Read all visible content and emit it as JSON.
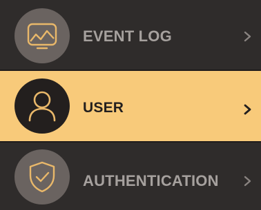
{
  "menu": {
    "items": [
      {
        "label": "EVENT LOG",
        "icon": "image-icon",
        "selected": false
      },
      {
        "label": "USER",
        "icon": "user-icon",
        "selected": true
      },
      {
        "label": "AUTHENTICATION",
        "icon": "shield-check-icon",
        "selected": false
      }
    ]
  },
  "colors": {
    "background": "#2f2c2b",
    "selected_background": "#f8ca7a",
    "accent": "#e9b86a",
    "inactive_text": "#a6a19e",
    "selected_text": "#231f1e",
    "icon_circle_inactive": "#6a6360",
    "icon_circle_active": "#231f1e"
  }
}
